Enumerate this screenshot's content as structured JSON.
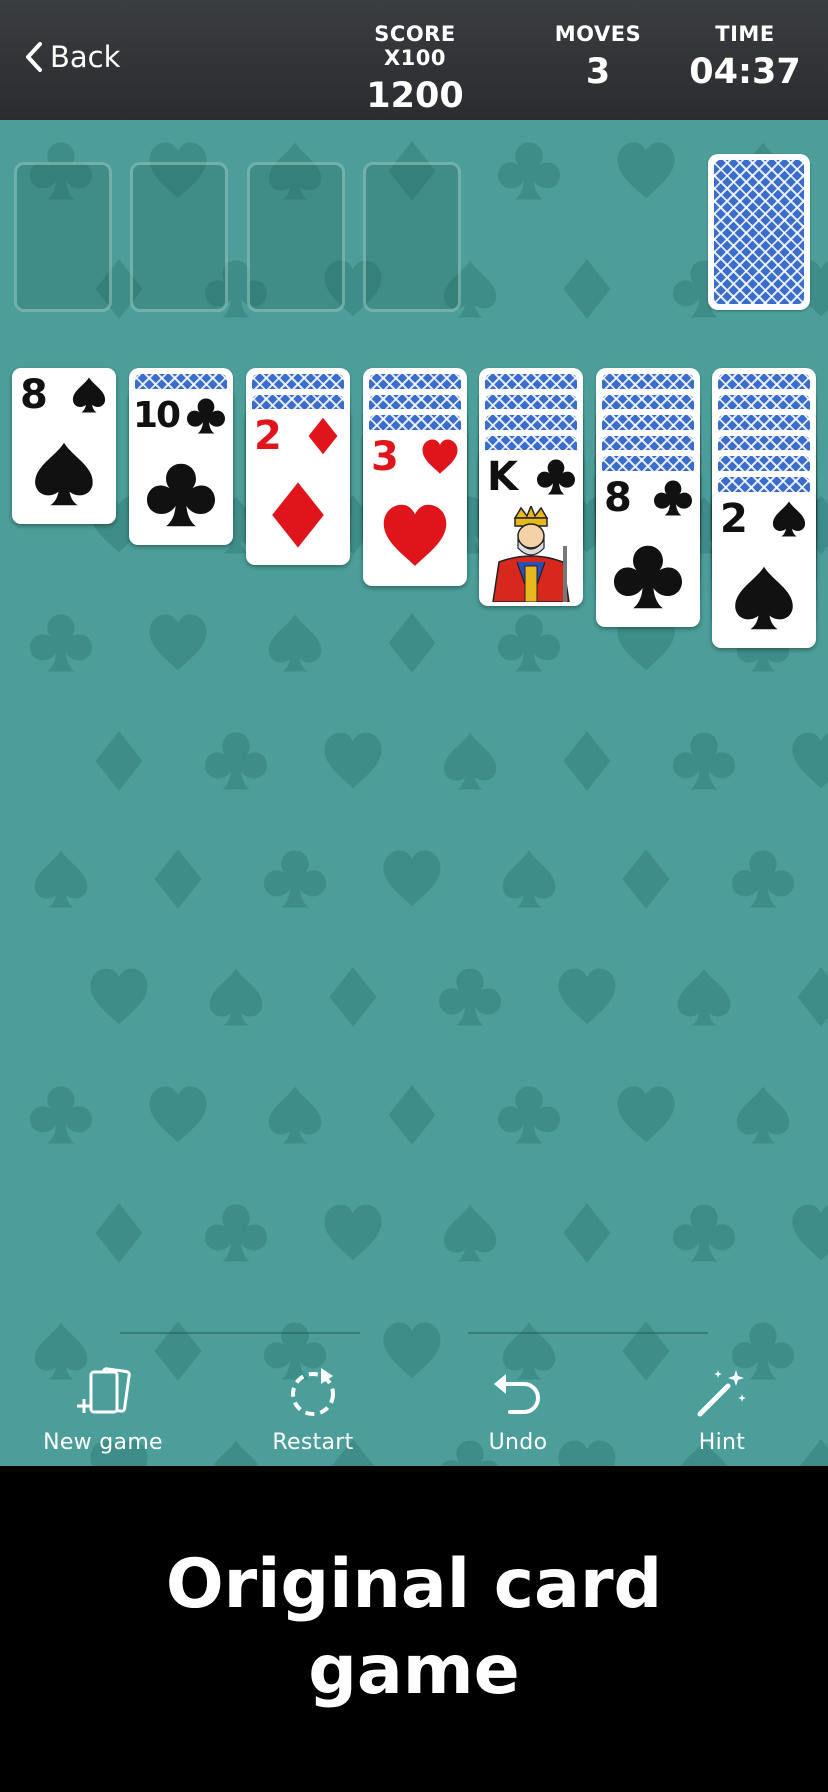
{
  "header": {
    "back_label": "Back",
    "score_label": "SCORE X100",
    "score_value": "1200",
    "moves_label": "MOVES",
    "moves_value": "3",
    "time_label": "TIME",
    "time_value": "04:37"
  },
  "colors": {
    "felt": "#4b9e99",
    "card_back": "#3b6dcc",
    "red_suit": "#e0151b",
    "black_suit": "#111111"
  },
  "foundations": [
    {
      "name": "foundation-1"
    },
    {
      "name": "foundation-2"
    },
    {
      "name": "foundation-3"
    },
    {
      "name": "foundation-4"
    }
  ],
  "tableau": [
    {
      "face_down": 0,
      "top": {
        "rank": "8",
        "suit": "spade-icon",
        "color": "black"
      }
    },
    {
      "face_down": 1,
      "top": {
        "rank": "10",
        "suit": "club-icon",
        "color": "black"
      }
    },
    {
      "face_down": 2,
      "top": {
        "rank": "2",
        "suit": "diamond-icon",
        "color": "red"
      }
    },
    {
      "face_down": 3,
      "top": {
        "rank": "3",
        "suit": "heart-icon",
        "color": "red"
      }
    },
    {
      "face_down": 4,
      "top": {
        "rank": "K",
        "suit": "club-icon",
        "color": "black",
        "court": "king"
      }
    },
    {
      "face_down": 5,
      "top": {
        "rank": "8",
        "suit": "club-icon",
        "color": "black"
      }
    },
    {
      "face_down": 6,
      "top": {
        "rank": "2",
        "suit": "spade-icon",
        "color": "black"
      }
    }
  ],
  "toolbar": {
    "new_game": "New game",
    "restart": "Restart",
    "undo": "Undo",
    "hint": "Hint"
  },
  "promo": {
    "line1": "Original card",
    "line2": "game"
  }
}
